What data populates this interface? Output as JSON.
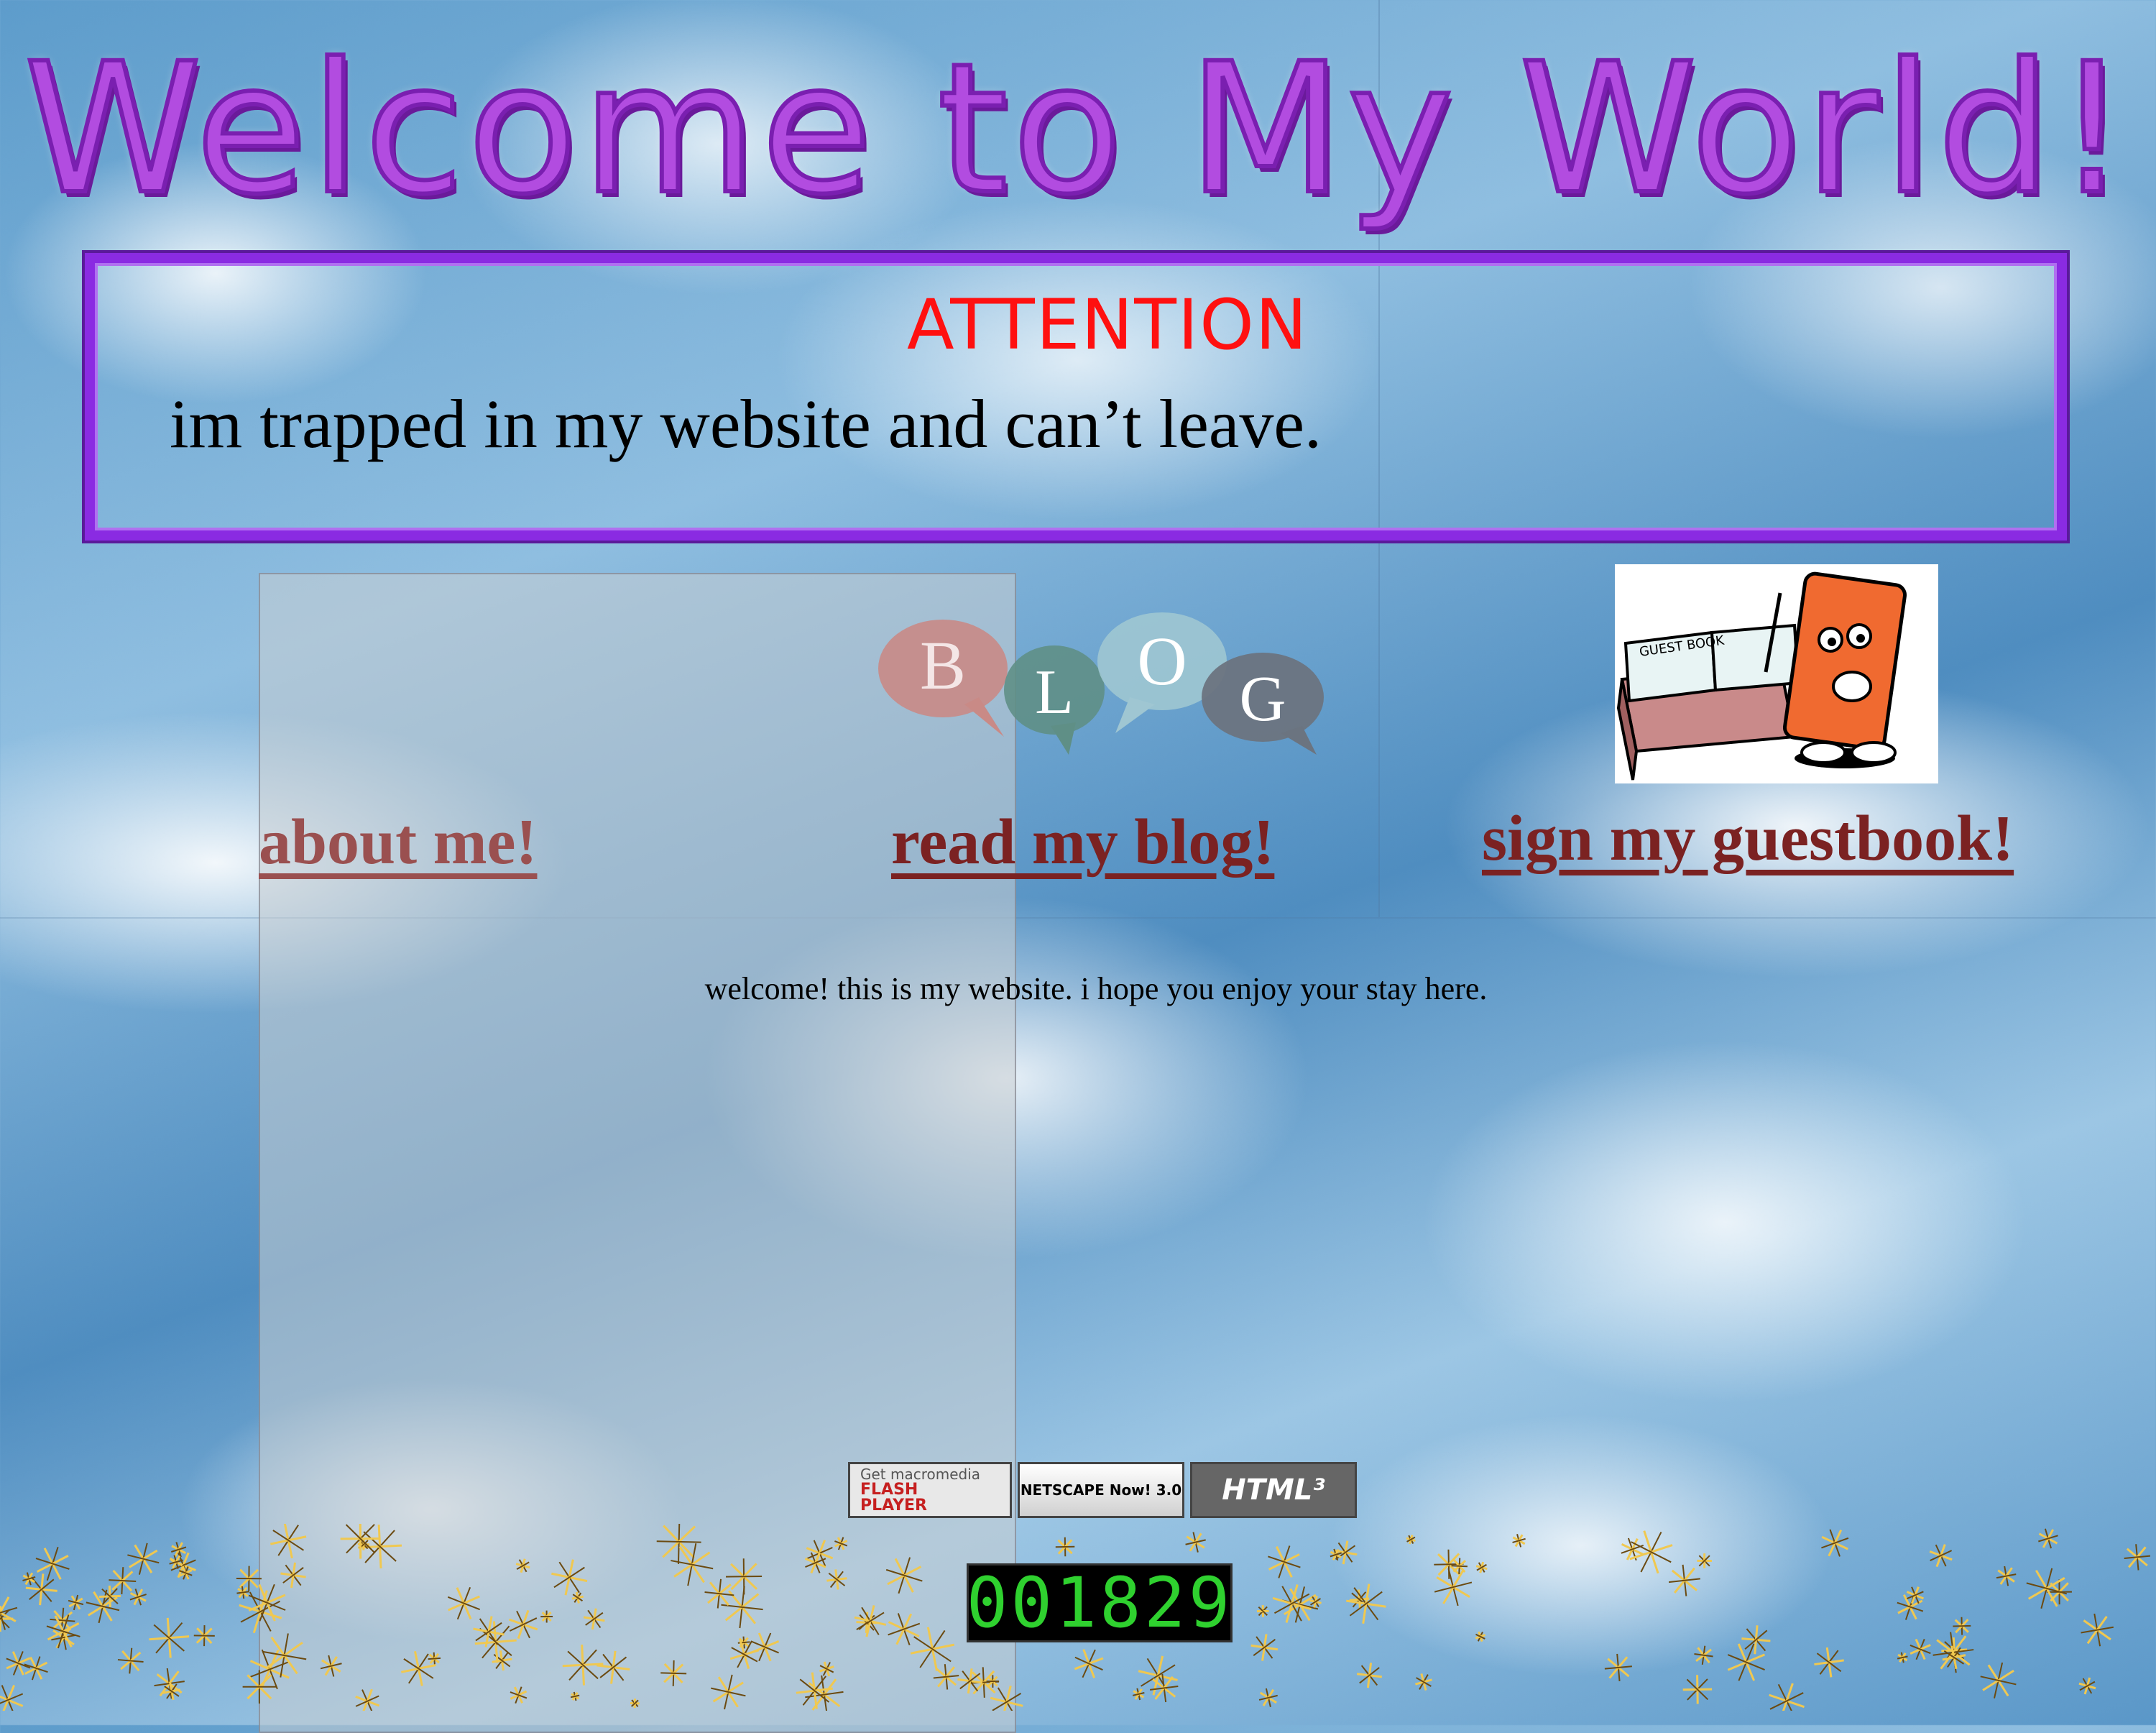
{
  "header": {
    "title": "Welcome to My World!"
  },
  "attention": {
    "heading": "ATTENTION",
    "message": "im trapped in my website and can’t leave."
  },
  "blog_logo": {
    "letters": [
      "B",
      "L",
      "O",
      "G"
    ],
    "colors": [
      "#c98a86",
      "#5f8f86",
      "#9fc6d2",
      "#6b7480"
    ]
  },
  "guestbook_image": {
    "book_text": "GUEST BOOK"
  },
  "nav": {
    "about_label": "about me!",
    "blog_label": "read my blog!",
    "guestbook_label": "sign my guestbook!"
  },
  "main": {
    "welcome_text": "welcome! this is my website. i hope you enjoy your stay here."
  },
  "badges": {
    "flash_line1": "Get macromedia",
    "flash_line2": "FLASH",
    "flash_line3": "PLAYER",
    "netscape_text": "NETSCAPE Now! 3.0",
    "html_text": "HTML³"
  },
  "counter": {
    "value": "001829"
  },
  "colors": {
    "title": "#b24ce0",
    "attention": "#ff1010",
    "border": "#8a2be2",
    "link": "#7b2222",
    "counter": "#2fd12f"
  }
}
